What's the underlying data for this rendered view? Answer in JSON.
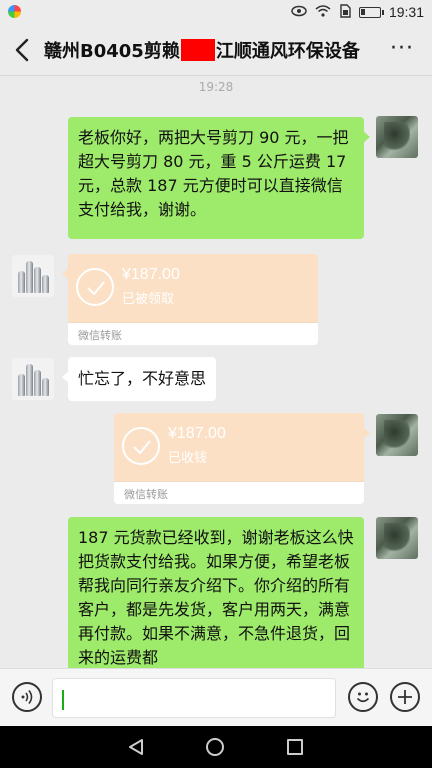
{
  "status_bar": {
    "time": "19:31",
    "icons": [
      "eye-icon",
      "wifi-icon",
      "sim-icon",
      "battery-icon"
    ]
  },
  "header": {
    "title_prefix": "赣州B0405剪赖",
    "title_suffix": "江顺通风环保设备",
    "more_label": "···"
  },
  "chat": {
    "timestamp": "19:28",
    "messages": [
      {
        "from": "self",
        "type": "text",
        "text": "老板你好，两把大号剪刀 90 元，一把超大号剪刀 80 元，重 5 公斤运费 17 元，总款 187 元方便时可以直接微信支付给我，谢谢。"
      },
      {
        "from": "other",
        "type": "transfer",
        "amount": "¥187.00",
        "status": "已被领取",
        "label": "微信转账"
      },
      {
        "from": "other",
        "type": "text",
        "text": "忙忘了，不好意思"
      },
      {
        "from": "self",
        "type": "transfer",
        "amount": "¥187.00",
        "status": "已收钱",
        "label": "微信转账"
      },
      {
        "from": "self",
        "type": "text",
        "text": "187 元货款已经收到，谢谢老板这么快把货款支付给我。如果方便，希望老板帮我向同行亲友介绍下。你介绍的所有客户，都是先发货，客户用两天，满意再付款。如果不满意，不急件退货，回来的运费都"
      }
    ]
  },
  "colors": {
    "self_bubble": "#9eea6a",
    "transfer_card": "#fbe0c5",
    "redaction": "#ff0000",
    "cursor": "#1aad19"
  }
}
